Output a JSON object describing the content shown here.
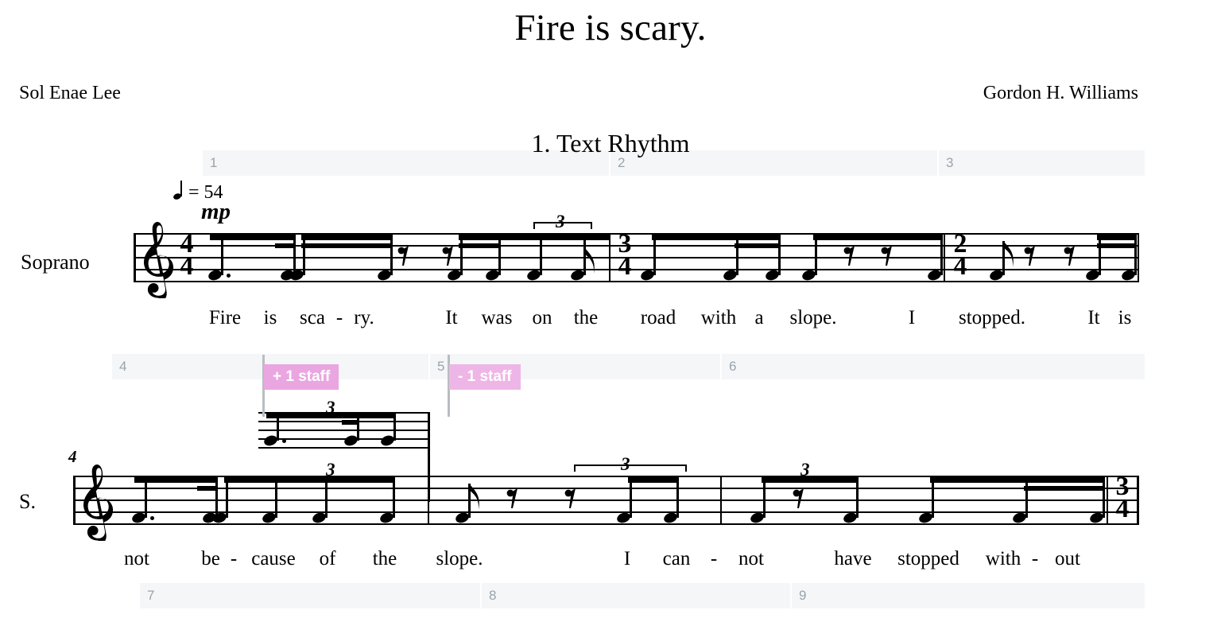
{
  "header": {
    "work_title": "Fire is scary.",
    "credit_left": "Sol Enae Lee",
    "credit_right": "Gordon H. Williams",
    "movement_title": "1. Text Rhythm"
  },
  "score": {
    "tempo_text": "= 54",
    "tempo_beat_icon": "quarter-note-icon",
    "dynamic": "mp",
    "clef": "treble-clef-icon",
    "part_label_full": "Soprano",
    "part_label_short": "S.",
    "system2_measure_number": "4"
  },
  "measure_strips": [
    {
      "numbers": [
        "1",
        "2",
        "3"
      ]
    },
    {
      "numbers": [
        "4",
        "5",
        "6"
      ]
    },
    {
      "numbers": [
        "7",
        "8",
        "9"
      ]
    }
  ],
  "badges": [
    {
      "label": "+ 1 staff",
      "color": "#eaa6e0"
    },
    {
      "label": "- 1 staff",
      "color": "#eeb6e6"
    }
  ],
  "time_signatures": [
    {
      "numerator": "4",
      "denominator": "4"
    },
    {
      "numerator": "3",
      "denominator": "4"
    },
    {
      "numerator": "2",
      "denominator": "4"
    },
    {
      "numerator": "3",
      "denominator": "4"
    }
  ],
  "tuplets": [
    {
      "number": "3",
      "bracket": true
    },
    {
      "number": "3",
      "bracket": false
    },
    {
      "number": "3",
      "bracket": false
    },
    {
      "number": "3",
      "bracket": true
    },
    {
      "number": "3",
      "bracket": false
    }
  ],
  "lyrics_system1": [
    "Fire",
    "is",
    "sca",
    "-",
    "ry.",
    "It",
    "was",
    "on",
    "the",
    "road",
    "with",
    "a",
    "slope.",
    "I",
    "stopped.",
    "It",
    "is"
  ],
  "lyrics_system2": [
    "not",
    "be",
    "-",
    "cause",
    "of",
    "the",
    "slope.",
    "I",
    "can",
    "-",
    "not",
    "have",
    "stopped",
    "with",
    "-",
    "out"
  ]
}
